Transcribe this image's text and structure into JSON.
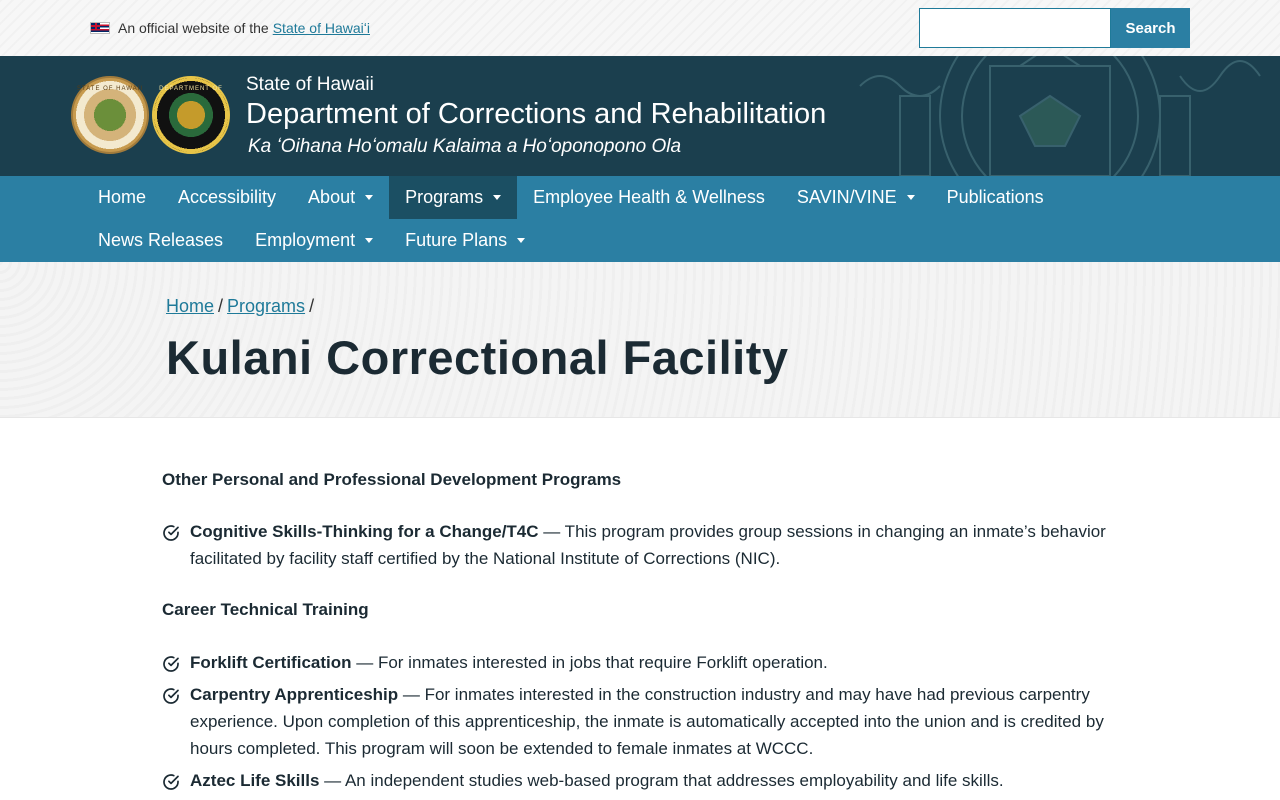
{
  "topbar": {
    "official_prefix": "An official website of the",
    "official_link": "State of Hawaiʻi",
    "search_placeholder": "",
    "search_button": "Search"
  },
  "header": {
    "subtitle": "State of Hawaii",
    "title": "Department of Corrections and Rehabilitation",
    "hawaiian": "Ka ʻOihana Hoʻomalu Kalaima a Hoʻoponopono Ola",
    "seal1_text": "STATE OF HAWAII",
    "seal2_text": "DEPARTMENT OF"
  },
  "nav": {
    "row1": [
      {
        "label": "Home",
        "caret": false,
        "active": false
      },
      {
        "label": "Accessibility",
        "caret": false,
        "active": false
      },
      {
        "label": "About",
        "caret": true,
        "active": false
      },
      {
        "label": "Programs",
        "caret": true,
        "active": true
      },
      {
        "label": "Employee Health & Wellness",
        "caret": false,
        "active": false
      },
      {
        "label": "SAVIN/VINE",
        "caret": true,
        "active": false
      },
      {
        "label": "Publications",
        "caret": false,
        "active": false
      }
    ],
    "row2": [
      {
        "label": "News Releases",
        "caret": false,
        "active": false
      },
      {
        "label": "Employment",
        "caret": true,
        "active": false
      },
      {
        "label": "Future Plans",
        "caret": true,
        "active": false
      }
    ]
  },
  "breadcrumb": {
    "home": "Home",
    "programs": "Programs",
    "sep": "/"
  },
  "page_title": "Kulani Correctional Facility",
  "content": {
    "section1_heading": "Other Personal and Professional Development Programs",
    "section1_items": [
      {
        "title": "Cognitive Skills-Thinking for a Change/T4C",
        "text": " — This program provides group sessions in changing an inmate’s behavior facilitated by facility staff certified by the National Institute of Corrections (NIC)."
      }
    ],
    "section2_heading": "Career Technical Training",
    "section2_items": [
      {
        "title": "Forklift Certification",
        "text": " — For inmates interested in jobs that require Forklift operation."
      },
      {
        "title": "Carpentry Apprenticeship",
        "text": " — For inmates interested in the construction industry and may have had previous carpentry experience. Upon completion of this apprenticeship, the inmate is automatically accepted into the union and is credited by hours completed. This program will soon be extended to female inmates at WCCC."
      },
      {
        "title": "Aztec Life Skills",
        "text": " — An independent studies web-based program that addresses employability and life skills."
      }
    ]
  },
  "icons": {
    "flag": "hawaii-flag-icon",
    "check": "check-circle-icon",
    "caret": "caret-down-icon"
  },
  "colors": {
    "header_bg": "#1b3f4e",
    "nav_bg": "#2b7fa3",
    "nav_active": "#1b4f63",
    "link": "#1f7a99"
  }
}
